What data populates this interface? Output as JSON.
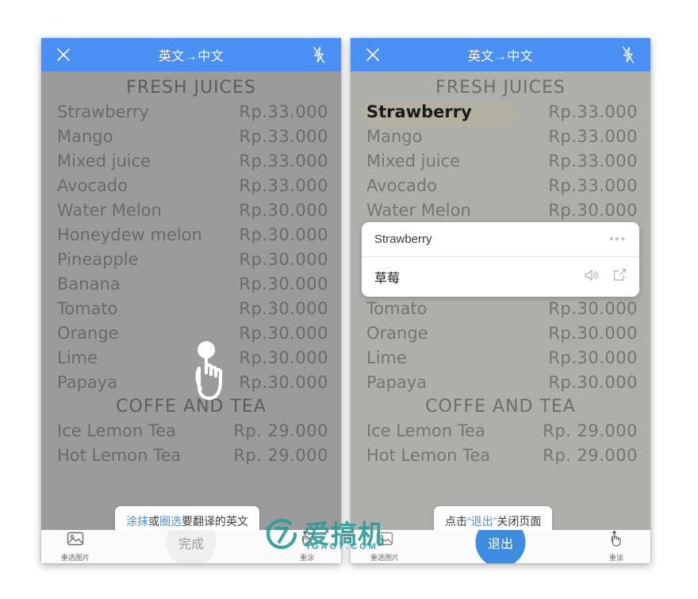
{
  "app": {
    "header": {
      "title": "英文→中文",
      "close_icon": "close-icon",
      "flash_icon": "flash-off-icon"
    }
  },
  "menu": {
    "section_juices": "FRESH JUICES",
    "section_coffee": "COFFE AND TEA",
    "items": [
      {
        "name": "Strawberry",
        "price": "Rp.33.000"
      },
      {
        "name": "Mango",
        "price": "Rp.33.000"
      },
      {
        "name": "Mixed juice",
        "price": "Rp.33.000"
      },
      {
        "name": "Avocado",
        "price": "Rp.33.000"
      },
      {
        "name": "Water Melon",
        "price": "Rp.30.000"
      },
      {
        "name": "Honeydew melon",
        "price": "Rp.30.000"
      },
      {
        "name": "Pineapple",
        "price": "Rp.30.000"
      },
      {
        "name": "Banana",
        "price": "Rp.30.000"
      },
      {
        "name": "Tomato",
        "price": "Rp.30.000"
      },
      {
        "name": "Orange",
        "price": "Rp.30.000"
      },
      {
        "name": "Lime",
        "price": "Rp.30.000"
      },
      {
        "name": "Papaya",
        "price": "Rp.30.000"
      }
    ],
    "coffee_items": [
      {
        "name": "Ice Lemon Tea",
        "price": "Rp. 29.000"
      },
      {
        "name": "Hot Lemon Tea",
        "price": "Rp. 29.000"
      }
    ]
  },
  "left_panel": {
    "tooltip": {
      "part1": "涂抹",
      "part2": "或",
      "part3": "圈选",
      "part4": "要翻译的英文"
    },
    "bottom": {
      "reselect_label": "重选图片",
      "reselect_icon": "photo-icon",
      "center_label": "完成",
      "repaint_label": "重涂",
      "repaint_icon": "hand-tap-icon"
    },
    "cursor_icon": "hand-tap-cursor-icon"
  },
  "right_panel": {
    "highlighted_word": "Strawberry",
    "card": {
      "source_text": "Strawberry",
      "target_text": "草莓",
      "more_icon": "more-dots-icon",
      "speaker_icon": "speaker-icon",
      "share_icon": "share-icon"
    },
    "tooltip": {
      "part1": "点击",
      "part2": "“退出”",
      "part3": "关闭页面"
    },
    "bottom": {
      "reselect_label": "重选图片",
      "reselect_icon": "photo-icon",
      "center_label": "退出",
      "repaint_label": "重涂",
      "repaint_icon": "hand-tap-icon"
    }
  },
  "watermark": {
    "text": "爱搞机",
    "sub": "IGAO7.COM",
    "logo_digit": "7",
    "color": "#2f9c9a"
  },
  "colors": {
    "accent_blue": "#4a90f4",
    "exit_button": "#3d8ce0",
    "photo_bg_dim": "#9b9b9b",
    "photo_bg_light": "#aeaeaa"
  }
}
